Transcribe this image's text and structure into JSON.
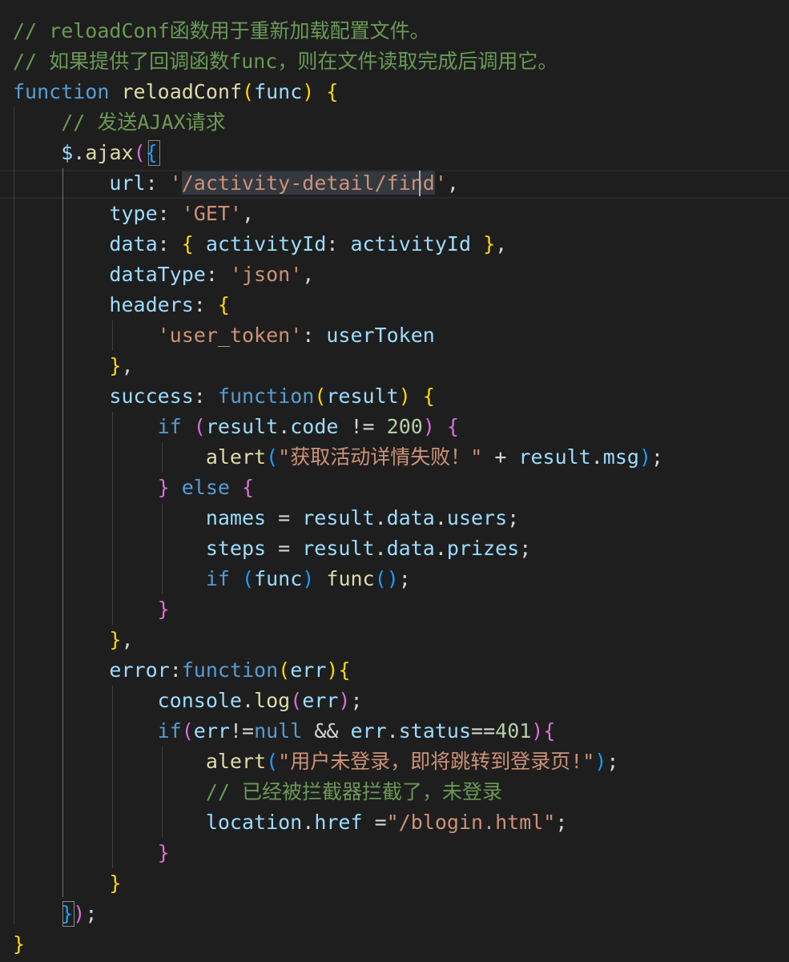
{
  "editor": {
    "theme_colors": {
      "background": "#1e1e1e",
      "comment": "#6a9955",
      "keyword": "#569cd6",
      "function": "#dcdcaa",
      "variable": "#9cdcfe",
      "string": "#ce9178",
      "number": "#b5cea8",
      "bracket_level1": "#ffd700",
      "bracket_level2": "#da70d6",
      "bracket_level3": "#179fff"
    },
    "lines": [
      [
        {
          "t": "// reloadConf函数用于重新加载配置文件。",
          "c": "c"
        }
      ],
      [
        {
          "t": "// 如果提供了回调函数func，则在文件读取完成后调用它。",
          "c": "c"
        }
      ],
      [
        {
          "t": "function",
          "c": "k"
        },
        {
          "t": " ",
          "c": "p"
        },
        {
          "t": "reloadConf",
          "c": "f"
        },
        {
          "t": "(",
          "c": "b1"
        },
        {
          "t": "func",
          "c": "v"
        },
        {
          "t": ")",
          "c": "b1"
        },
        {
          "t": " ",
          "c": "p"
        },
        {
          "t": "{",
          "c": "b1"
        }
      ],
      [
        {
          "t": "    ",
          "c": "p"
        },
        {
          "t": "// 发送AJAX请求",
          "c": "c"
        }
      ],
      [
        {
          "t": "    ",
          "c": "p"
        },
        {
          "t": "$",
          "c": "v"
        },
        {
          "t": ".",
          "c": "p"
        },
        {
          "t": "ajax",
          "c": "f"
        },
        {
          "t": "(",
          "c": "b2"
        },
        {
          "t": "{",
          "c": "b3"
        }
      ],
      [
        {
          "t": "        ",
          "c": "p"
        },
        {
          "t": "url",
          "c": "v"
        },
        {
          "t": ": ",
          "c": "p"
        },
        {
          "t": "'",
          "c": "s"
        },
        {
          "t": "/activity-detail/fi",
          "c": "s hl"
        },
        {
          "t": "nd",
          "c": "s hl"
        },
        {
          "t": "'",
          "c": "s"
        },
        {
          "t": ",",
          "c": "p"
        }
      ],
      [
        {
          "t": "        ",
          "c": "p"
        },
        {
          "t": "type",
          "c": "v"
        },
        {
          "t": ": ",
          "c": "p"
        },
        {
          "t": "'GET'",
          "c": "s"
        },
        {
          "t": ",",
          "c": "p"
        }
      ],
      [
        {
          "t": "        ",
          "c": "p"
        },
        {
          "t": "data",
          "c": "v"
        },
        {
          "t": ": ",
          "c": "p"
        },
        {
          "t": "{",
          "c": "b1"
        },
        {
          "t": " ",
          "c": "p"
        },
        {
          "t": "activityId",
          "c": "v"
        },
        {
          "t": ": ",
          "c": "p"
        },
        {
          "t": "activityId",
          "c": "v"
        },
        {
          "t": " ",
          "c": "p"
        },
        {
          "t": "}",
          "c": "b1"
        },
        {
          "t": ",",
          "c": "p"
        }
      ],
      [
        {
          "t": "        ",
          "c": "p"
        },
        {
          "t": "dataType",
          "c": "v"
        },
        {
          "t": ": ",
          "c": "p"
        },
        {
          "t": "'json'",
          "c": "s"
        },
        {
          "t": ",",
          "c": "p"
        }
      ],
      [
        {
          "t": "        ",
          "c": "p"
        },
        {
          "t": "headers",
          "c": "v"
        },
        {
          "t": ": ",
          "c": "p"
        },
        {
          "t": "{",
          "c": "b1"
        }
      ],
      [
        {
          "t": "            ",
          "c": "p"
        },
        {
          "t": "'user_token'",
          "c": "s"
        },
        {
          "t": ": ",
          "c": "p"
        },
        {
          "t": "userToken",
          "c": "v"
        }
      ],
      [
        {
          "t": "        ",
          "c": "p"
        },
        {
          "t": "}",
          "c": "b1"
        },
        {
          "t": ",",
          "c": "p"
        }
      ],
      [
        {
          "t": "        ",
          "c": "p"
        },
        {
          "t": "success",
          "c": "v"
        },
        {
          "t": ": ",
          "c": "p"
        },
        {
          "t": "function",
          "c": "k"
        },
        {
          "t": "(",
          "c": "b1"
        },
        {
          "t": "result",
          "c": "v"
        },
        {
          "t": ")",
          "c": "b1"
        },
        {
          "t": " ",
          "c": "p"
        },
        {
          "t": "{",
          "c": "b1"
        }
      ],
      [
        {
          "t": "            ",
          "c": "p"
        },
        {
          "t": "if",
          "c": "kw"
        },
        {
          "t": " ",
          "c": "p"
        },
        {
          "t": "(",
          "c": "b2"
        },
        {
          "t": "result",
          "c": "v"
        },
        {
          "t": ".",
          "c": "p"
        },
        {
          "t": "code",
          "c": "v"
        },
        {
          "t": " != ",
          "c": "p"
        },
        {
          "t": "200",
          "c": "n"
        },
        {
          "t": ")",
          "c": "b2"
        },
        {
          "t": " ",
          "c": "p"
        },
        {
          "t": "{",
          "c": "b2"
        }
      ],
      [
        {
          "t": "                ",
          "c": "p"
        },
        {
          "t": "alert",
          "c": "f"
        },
        {
          "t": "(",
          "c": "b3"
        },
        {
          "t": "\"获取活动详情失败！\"",
          "c": "s"
        },
        {
          "t": " + ",
          "c": "p"
        },
        {
          "t": "result",
          "c": "v"
        },
        {
          "t": ".",
          "c": "p"
        },
        {
          "t": "msg",
          "c": "v"
        },
        {
          "t": ")",
          "c": "b3"
        },
        {
          "t": ";",
          "c": "p"
        }
      ],
      [
        {
          "t": "            ",
          "c": "p"
        },
        {
          "t": "}",
          "c": "b2"
        },
        {
          "t": " ",
          "c": "p"
        },
        {
          "t": "else",
          "c": "kw"
        },
        {
          "t": " ",
          "c": "p"
        },
        {
          "t": "{",
          "c": "b2"
        }
      ],
      [
        {
          "t": "                ",
          "c": "p"
        },
        {
          "t": "names",
          "c": "v"
        },
        {
          "t": " = ",
          "c": "p"
        },
        {
          "t": "result",
          "c": "v"
        },
        {
          "t": ".",
          "c": "p"
        },
        {
          "t": "data",
          "c": "v"
        },
        {
          "t": ".",
          "c": "p"
        },
        {
          "t": "users",
          "c": "v"
        },
        {
          "t": ";",
          "c": "p"
        }
      ],
      [
        {
          "t": "                ",
          "c": "p"
        },
        {
          "t": "steps",
          "c": "v"
        },
        {
          "t": " = ",
          "c": "p"
        },
        {
          "t": "result",
          "c": "v"
        },
        {
          "t": ".",
          "c": "p"
        },
        {
          "t": "data",
          "c": "v"
        },
        {
          "t": ".",
          "c": "p"
        },
        {
          "t": "prizes",
          "c": "v"
        },
        {
          "t": ";",
          "c": "p"
        }
      ],
      [
        {
          "t": "                ",
          "c": "p"
        },
        {
          "t": "if",
          "c": "kw"
        },
        {
          "t": " ",
          "c": "p"
        },
        {
          "t": "(",
          "c": "b3"
        },
        {
          "t": "func",
          "c": "v"
        },
        {
          "t": ")",
          "c": "b3"
        },
        {
          "t": " ",
          "c": "p"
        },
        {
          "t": "func",
          "c": "f"
        },
        {
          "t": "(",
          "c": "b3"
        },
        {
          "t": ")",
          "c": "b3"
        },
        {
          "t": ";",
          "c": "p"
        }
      ],
      [
        {
          "t": "            ",
          "c": "p"
        },
        {
          "t": "}",
          "c": "b2"
        }
      ],
      [
        {
          "t": "        ",
          "c": "p"
        },
        {
          "t": "}",
          "c": "b1"
        },
        {
          "t": ",",
          "c": "p"
        }
      ],
      [
        {
          "t": "        ",
          "c": "p"
        },
        {
          "t": "error",
          "c": "v"
        },
        {
          "t": ":",
          "c": "p"
        },
        {
          "t": "function",
          "c": "k"
        },
        {
          "t": "(",
          "c": "b1"
        },
        {
          "t": "err",
          "c": "v"
        },
        {
          "t": ")",
          "c": "b1"
        },
        {
          "t": "{",
          "c": "b1"
        }
      ],
      [
        {
          "t": "            ",
          "c": "p"
        },
        {
          "t": "console",
          "c": "v"
        },
        {
          "t": ".",
          "c": "p"
        },
        {
          "t": "log",
          "c": "f"
        },
        {
          "t": "(",
          "c": "b2"
        },
        {
          "t": "err",
          "c": "v"
        },
        {
          "t": ")",
          "c": "b2"
        },
        {
          "t": ";",
          "c": "p"
        }
      ],
      [
        {
          "t": "            ",
          "c": "p"
        },
        {
          "t": "if",
          "c": "kw"
        },
        {
          "t": "(",
          "c": "b2"
        },
        {
          "t": "err",
          "c": "v"
        },
        {
          "t": "!=",
          "c": "p"
        },
        {
          "t": "null",
          "c": "k"
        },
        {
          "t": " && ",
          "c": "p"
        },
        {
          "t": "err",
          "c": "v"
        },
        {
          "t": ".",
          "c": "p"
        },
        {
          "t": "status",
          "c": "v"
        },
        {
          "t": "==",
          "c": "p"
        },
        {
          "t": "401",
          "c": "n"
        },
        {
          "t": ")",
          "c": "b2"
        },
        {
          "t": "{",
          "c": "b2"
        }
      ],
      [
        {
          "t": "                ",
          "c": "p"
        },
        {
          "t": "alert",
          "c": "f"
        },
        {
          "t": "(",
          "c": "b3"
        },
        {
          "t": "\"用户未登录，即将跳转到登录页!\"",
          "c": "s"
        },
        {
          "t": ")",
          "c": "b3"
        },
        {
          "t": ";",
          "c": "p"
        }
      ],
      [
        {
          "t": "                ",
          "c": "p"
        },
        {
          "t": "// 已经被拦截器拦截了，未登录",
          "c": "c"
        }
      ],
      [
        {
          "t": "                ",
          "c": "p"
        },
        {
          "t": "location",
          "c": "v"
        },
        {
          "t": ".",
          "c": "p"
        },
        {
          "t": "href",
          "c": "v"
        },
        {
          "t": " =",
          "c": "p"
        },
        {
          "t": "\"/blogin.html\"",
          "c": "s"
        },
        {
          "t": ";",
          "c": "p"
        }
      ],
      [
        {
          "t": "            ",
          "c": "p"
        },
        {
          "t": "}",
          "c": "b2"
        }
      ],
      [
        {
          "t": "        ",
          "c": "p"
        },
        {
          "t": "}",
          "c": "b1"
        }
      ],
      [
        {
          "t": "    ",
          "c": "p"
        },
        {
          "t": "}",
          "c": "b3"
        },
        {
          "t": ")",
          "c": "b2"
        },
        {
          "t": ";",
          "c": "p"
        }
      ],
      [
        {
          "t": "}",
          "c": "b1"
        }
      ]
    ]
  }
}
